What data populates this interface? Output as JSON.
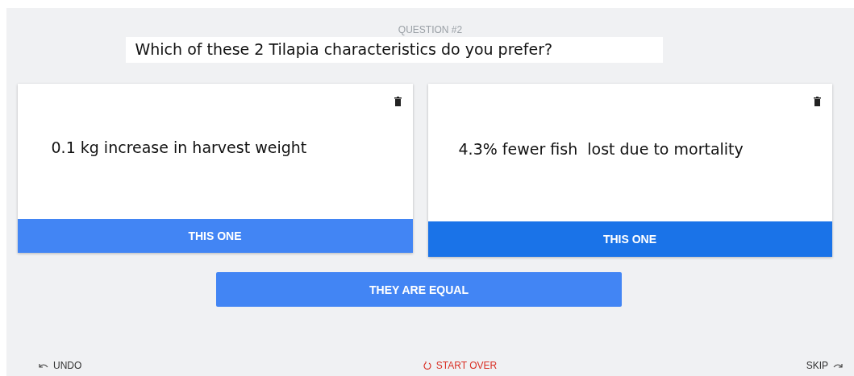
{
  "header": {
    "label": "QUESTION #2",
    "question": "Which of these 2 Tilapia characteristics do you prefer?"
  },
  "options": [
    {
      "text": "0.1 kg increase in harvest weight",
      "button": "THIS ONE",
      "selected": false
    },
    {
      "text": "4.3% fewer fish  lost due to mortality",
      "button": "THIS ONE",
      "selected": true
    }
  ],
  "equal_button": "THEY ARE EQUAL",
  "footer": {
    "undo": "UNDO",
    "start_over": "START OVER",
    "skip": "SKIP"
  }
}
